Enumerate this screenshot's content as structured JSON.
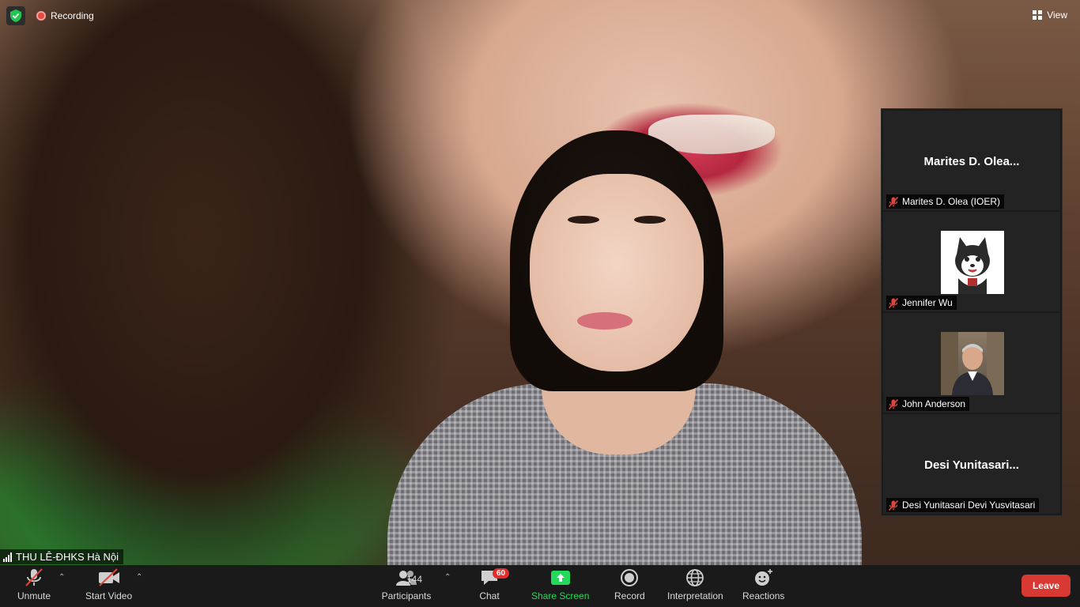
{
  "window": {
    "recording_label": "Recording",
    "view_label": "View"
  },
  "active_speaker": {
    "name": "THU LÊ-ĐHKS Hà Nội"
  },
  "participants_strip": [
    {
      "tile_title": "Marites  D.  Olea...",
      "label": "Marites D. Olea (IOER)",
      "type": "name"
    },
    {
      "tile_title": "",
      "label": "Jennifer Wu",
      "type": "avatar"
    },
    {
      "tile_title": "",
      "label": "John Anderson",
      "type": "photo"
    },
    {
      "tile_title": "Desi  Yunitasari...",
      "label": "Desi Yunitasari Devi Yusvitasari",
      "type": "name"
    }
  ],
  "toolbar": {
    "unmute": "Unmute",
    "start_video": "Start Video",
    "participants": "Participants",
    "participants_count": "144",
    "chat": "Chat",
    "chat_badge": "60",
    "share_screen": "Share Screen",
    "record": "Record",
    "interpretation": "Interpretation",
    "reactions": "Reactions",
    "leave": "Leave"
  },
  "colors": {
    "toolbar_bg": "#1a1a1a",
    "share_green": "#23d959",
    "leave_red": "#d83a33",
    "badge_red": "#e02e2e",
    "muted_red": "#e0453a"
  }
}
